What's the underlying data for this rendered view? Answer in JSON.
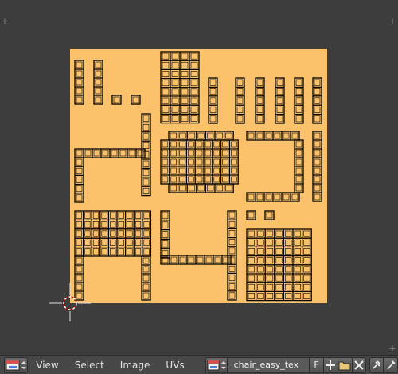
{
  "header": {
    "menus": [
      "View",
      "Select",
      "Image",
      "UVs"
    ],
    "image_name": "chair_easy_tex",
    "fake_user_label": "F"
  },
  "icons": {
    "editor_type": "uv-image-editor-icon",
    "image_browse": "image-browse-icon",
    "new_image": "plus-icon",
    "open_image": "folder-icon",
    "unlink_image": "close-icon",
    "pin": "pin-icon",
    "cursor": "2d-cursor-icon"
  },
  "colors": {
    "texture": "#fcc16b",
    "uv_line": "#000000",
    "background": "#3d3d3d"
  }
}
